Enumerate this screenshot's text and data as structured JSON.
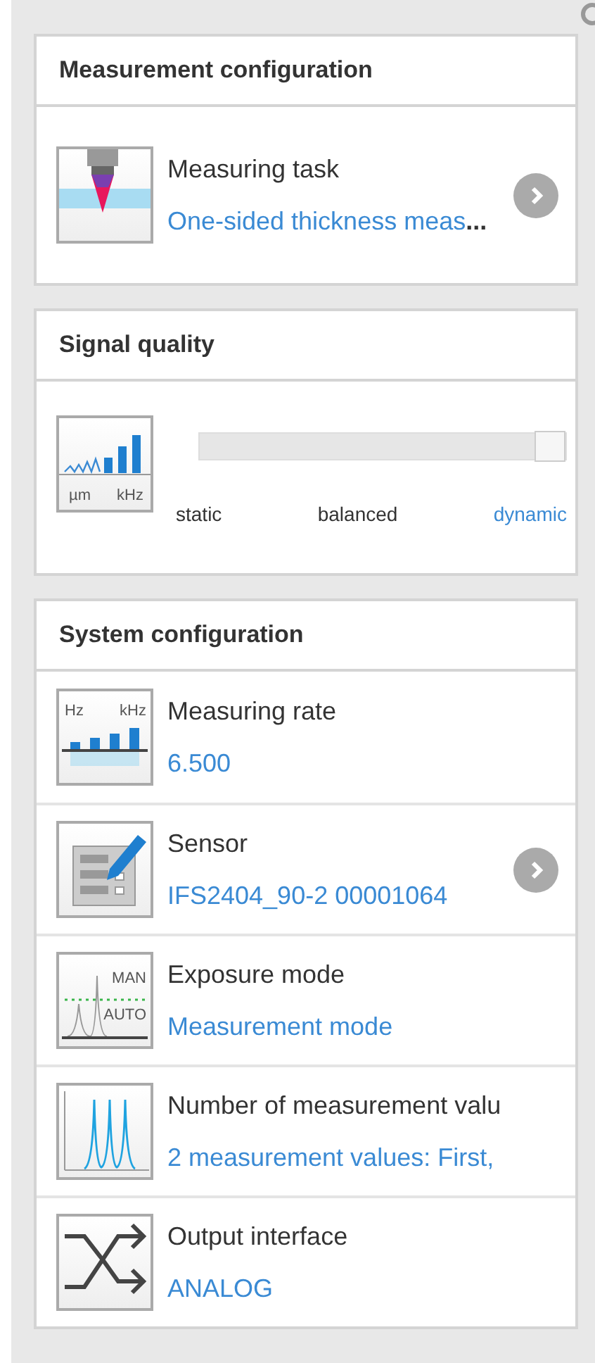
{
  "sections": [
    {
      "title": "Measurement configuration",
      "kind": "list",
      "items": [
        {
          "kind": "probe",
          "label": "Measuring task",
          "value": "One-sided thickness meas",
          "ellipsis": "...",
          "has_arrow": true
        }
      ]
    },
    {
      "title": "Signal quality",
      "kind": "slider",
      "icon_labels": [
        "µm",
        "kHz"
      ],
      "level": 1,
      "stops": [
        {
          "label": "static",
          "selected": false
        },
        {
          "label": "balanced",
          "selected": false
        },
        {
          "label": "dynamic",
          "selected": true
        }
      ]
    },
    {
      "title": "System configuration",
      "kind": "list",
      "items": [
        {
          "kind": "rate",
          "icon_labels": [
            "Hz",
            "kHz"
          ],
          "label": "Measuring rate",
          "value": "6.500",
          "has_arrow": false
        },
        {
          "kind": "sensor",
          "label": "Sensor",
          "value": "IFS2404_90-2 00001064",
          "has_arrow": true
        },
        {
          "kind": "exposure",
          "icon_labels": [
            "MAN",
            "AUTO"
          ],
          "label": "Exposure mode",
          "value": "Measurement mode",
          "has_arrow": false
        },
        {
          "kind": "peaks",
          "label": "Number of measurement valu",
          "value": "2 measurement values: First,",
          "has_arrow": false
        },
        {
          "kind": "output",
          "label": "Output interface",
          "value": "ANALOG",
          "has_arrow": false
        }
      ]
    }
  ]
}
